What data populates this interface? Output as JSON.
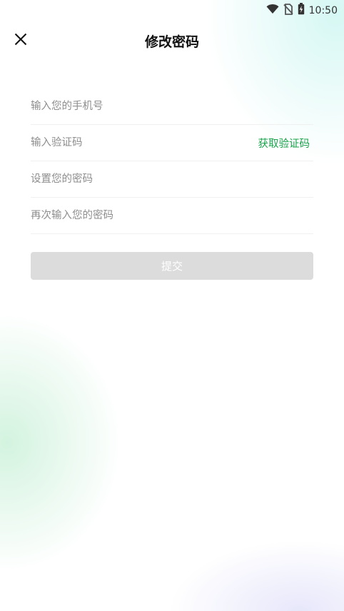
{
  "status_bar": {
    "time": "10:50",
    "icons": [
      "wifi-icon",
      "no-sim-icon",
      "battery-charging-icon"
    ]
  },
  "header": {
    "title": "修改密码",
    "close_icon": "close-icon"
  },
  "form": {
    "phone_placeholder": "输入您的手机号",
    "code_placeholder": "输入验证码",
    "get_code_label": "获取验证码",
    "password_placeholder": "设置您的密码",
    "confirm_placeholder": "再次输入您的密码",
    "submit_label": "提交"
  },
  "colors": {
    "accent": "#17a34a",
    "submit_disabled_bg": "#dcdcdc",
    "placeholder": "#8e8e8e"
  }
}
